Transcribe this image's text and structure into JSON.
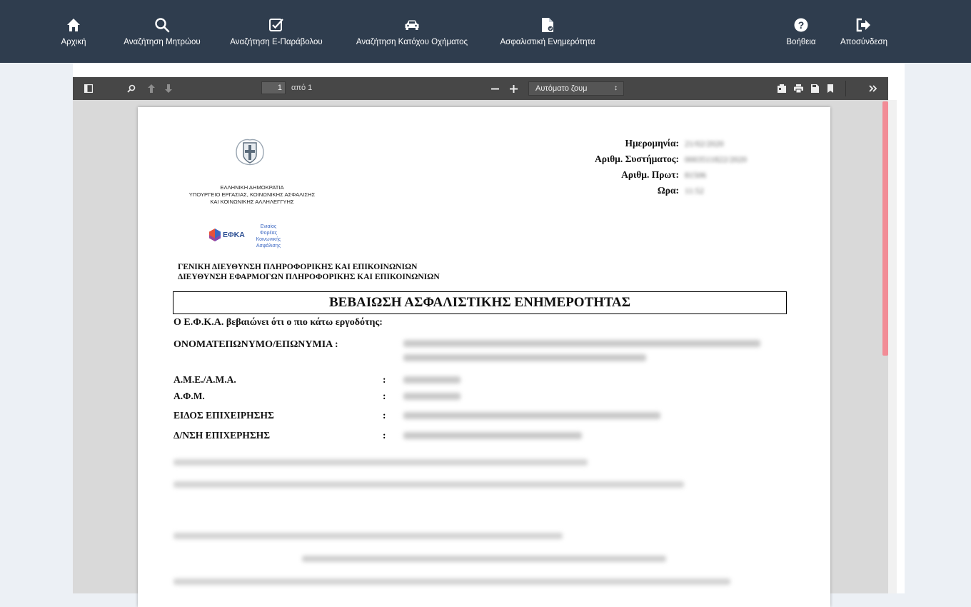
{
  "nav": {
    "items": [
      {
        "label": "Αρχική",
        "icon": "home-icon"
      },
      {
        "label": "Αναζήτηση Μητρώου",
        "icon": "search-icon"
      },
      {
        "label": "Αναζήτηση Ε-Παράβολου",
        "icon": "checkbox-icon"
      },
      {
        "label": "Αναζήτηση Κατόχου Οχήματος",
        "icon": "car-icon"
      },
      {
        "label": "Ασφαλιστική Ενημερότητα",
        "icon": "document-icon"
      },
      {
        "label": "Βοήθεια",
        "icon": "help-icon"
      },
      {
        "label": "Αποσύνδεση",
        "icon": "logout-icon"
      }
    ]
  },
  "pdf_toolbar": {
    "page_number": "1",
    "page_of": "από 1",
    "zoom_label": "Αυτόματο ζουμ"
  },
  "document": {
    "header_labels": {
      "date": "Ημερομηνία:",
      "system_no": "Αριθμ. Συστήματος:",
      "protocol_no": "Αριθμ. Πρωτ:",
      "time": "Ωρα:"
    },
    "header_values_blurred": {
      "date": "21/02/2020",
      "system_no": "0003511822/2020",
      "protocol_no": "81506",
      "time": "11:52"
    },
    "org": {
      "line1": "ΕΛΛΗΝΙΚΗ ΔΗΜΟΚΡΑΤΙΑ",
      "line2": "ΥΠΟΥΡΓΕΙΟ ΕΡΓΑΣΙΑΣ, ΚΟΙΝΩΝΙΚΗΣ ΑΣΦΑΛΙΣΗΣ",
      "line3": "ΚΑΙ ΚΟΙΝΩΝΙΚΗΣ ΑΛΛΗΛΕΓΓΥΗΣ",
      "efka_logo": "ΕΦΚΑ",
      "efka_tag1": "Ενιαίος",
      "efka_tag2": "Φορέας",
      "efka_tag3": "Κοινωνικής",
      "efka_tag4": "Ασφάλισης"
    },
    "directorate1": "ΓΕΝΙΚΗ ΔΙΕΥΘΥΝΣΗ ΠΛΗΡΟΦΟΡΙΚΗΣ ΚΑΙ ΕΠΙΚΟΙΝΩΝΙΩΝ",
    "directorate2": "ΔΙΕΥΘΥΝΣΗ ΕΦΑΡΜΟΓΩΝ ΠΛΗΡΟΦΟΡΙΚΗΣ ΚΑΙ ΕΠΙΚΟΙΝΩΝΙΩΝ",
    "title": "ΒΕΒΑΙΩΣΗ ΑΣΦΑΛΙΣΤΙΚΗΣ ΕΝΗΜΕΡΟΤΗΤΑΣ",
    "intro": "Ο Ε.Φ.Κ.Α. βεβαιώνει ότι ο πιο κάτω εργοδότης:",
    "fields": {
      "name_label": "ΟΝΟΜΑΤΕΠΩΝΥΜΟ/ΕΠΩΝΥΜΙΑ :",
      "ame_label": "Α.Μ.Ε./Α.Μ.Α.",
      "afm_label": "Α.Φ.Μ.",
      "type_label": "ΕΙΔΟΣ ΕΠΙΧΕΙΡΗΣΗΣ",
      "address_label": "Δ/ΝΣΗ ΕΠΙΧΕΡΗΣΗΣ",
      "colon": ":"
    }
  },
  "colors": {
    "nav_bg": "#2f3d4e",
    "toolbar_bg": "#474747",
    "scroll_thumb": "#f28c96"
  }
}
